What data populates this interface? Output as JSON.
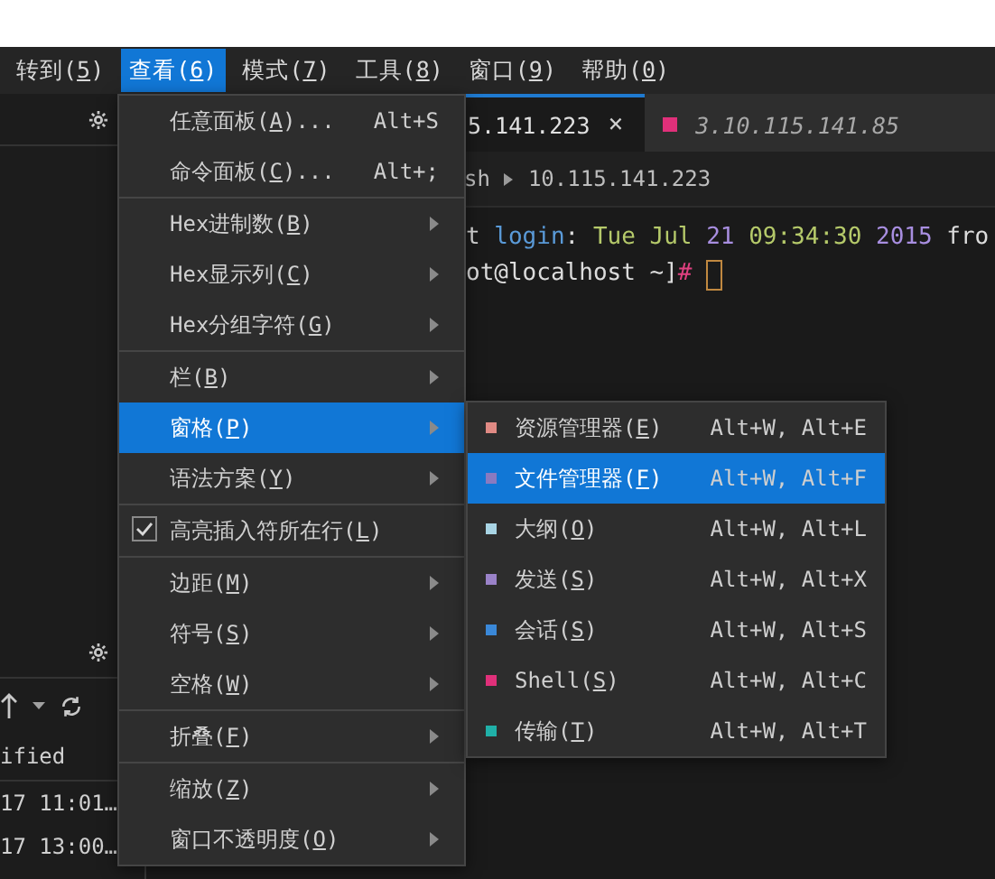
{
  "menubar": [
    {
      "label": "转到(5)",
      "selected": false
    },
    {
      "label": "查看(6)",
      "selected": true
    },
    {
      "label": "模式(7)",
      "selected": false
    },
    {
      "label": "工具(8)",
      "selected": false
    },
    {
      "label": "窗口(9)",
      "selected": false
    },
    {
      "label": "帮助(0)",
      "selected": false
    }
  ],
  "left_panel": {
    "table_header": "ified",
    "rows": [
      "17 11:01…",
      "17 13:00…"
    ]
  },
  "tabs": [
    {
      "label": "5.141.223",
      "selected": true,
      "close": "×"
    },
    {
      "label": "3.10.115.141.85",
      "selected": false,
      "color": "#e0307a"
    }
  ],
  "breadcrumb": [
    "sh",
    "10.115.141.223"
  ],
  "terminal": [
    [
      {
        "text": "t ",
        "kind": "plain"
      },
      {
        "text": "login",
        "kind": "keyword"
      },
      {
        "text": ": ",
        "kind": "plain"
      },
      {
        "text": "Tue Jul ",
        "kind": "date"
      },
      {
        "text": "21 ",
        "kind": "number"
      },
      {
        "text": "09:34:30 ",
        "kind": "date"
      },
      {
        "text": "2015 ",
        "kind": "number"
      },
      {
        "text": "fro",
        "kind": "plain"
      }
    ],
    [
      {
        "text": "ot@localhost ~]",
        "kind": "plain"
      },
      {
        "text": "#",
        "kind": "prompt"
      }
    ]
  ],
  "menu": [
    [
      {
        "label": "任意面板(A)...",
        "kind": "command",
        "shortcut": "Alt+S",
        "selected": false
      },
      {
        "label": "命令面板(C)...",
        "kind": "command",
        "shortcut": "Alt+;",
        "selected": false
      }
    ],
    [
      {
        "label": "Hex进制数(B)",
        "kind": "submenu",
        "selected": false
      },
      {
        "label": "Hex显示列(C)",
        "kind": "submenu",
        "selected": false
      },
      {
        "label": "Hex分组字符(G)",
        "kind": "submenu",
        "selected": false
      }
    ],
    [
      {
        "label": "栏(B)",
        "kind": "submenu",
        "selected": false
      },
      {
        "label": "窗格(P)",
        "kind": "submenu",
        "selected": true
      },
      {
        "label": "语法方案(Y)",
        "kind": "submenu",
        "selected": false
      }
    ],
    [
      {
        "label": "高亮插入符所在行(L)",
        "kind": "check",
        "checked": true,
        "selected": false
      }
    ],
    [
      {
        "label": "边距(M)",
        "kind": "submenu",
        "selected": false
      },
      {
        "label": "符号(S)",
        "kind": "submenu",
        "selected": false
      },
      {
        "label": "空格(W)",
        "kind": "submenu",
        "selected": false
      }
    ],
    [
      {
        "label": "折叠(F)",
        "kind": "submenu",
        "selected": false
      }
    ],
    [
      {
        "label": "缩放(Z)",
        "kind": "submenu",
        "selected": false
      },
      {
        "label": "窗口不透明度(O)",
        "kind": "submenu",
        "selected": false
      }
    ]
  ],
  "submenu": [
    {
      "label": "资源管理器(E)",
      "shortcut": "Alt+W, Alt+E",
      "color": "#e08a84",
      "selected": false
    },
    {
      "label": "文件管理器(F)",
      "shortcut": "Alt+W, Alt+F",
      "color": "#8a7ac0",
      "selected": true
    },
    {
      "label": "大纲(O)",
      "shortcut": "Alt+W, Alt+L",
      "color": "#a8d4e4",
      "selected": false
    },
    {
      "label": "发送(S)",
      "shortcut": "Alt+W, Alt+X",
      "color": "#9a82c8",
      "selected": false
    },
    {
      "label": "会话(S)",
      "shortcut": "Alt+W, Alt+S",
      "color": "#3a88d8",
      "selected": false
    },
    {
      "label": "Shell(S)",
      "shortcut": "Alt+W, Alt+C",
      "color": "#e0307a",
      "selected": false
    },
    {
      "label": "传输(T)",
      "shortcut": "Alt+W, Alt+T",
      "color": "#20b0a8",
      "selected": false
    }
  ]
}
